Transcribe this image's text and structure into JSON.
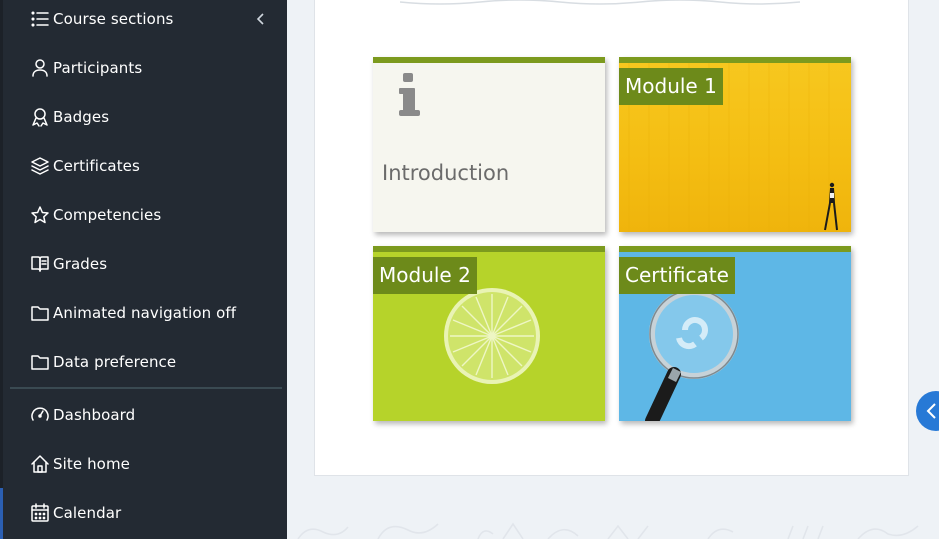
{
  "sidebar": {
    "collapse_icon": "chevron-left-icon",
    "items": [
      {
        "label": "Course sections",
        "icon": "list-icon"
      },
      {
        "label": "Participants",
        "icon": "user-icon"
      },
      {
        "label": "Badges",
        "icon": "badge-icon"
      },
      {
        "label": "Certificates",
        "icon": "layers-icon"
      },
      {
        "label": "Competencies",
        "icon": "star-icon"
      },
      {
        "label": "Grades",
        "icon": "book-icon"
      },
      {
        "label": "Animated navigation off",
        "icon": "folder-icon"
      },
      {
        "label": "Data preference",
        "icon": "folder-icon"
      }
    ],
    "site_items": [
      {
        "label": "Dashboard",
        "icon": "gauge-icon"
      },
      {
        "label": "Site home",
        "icon": "home-icon"
      },
      {
        "label": "Calendar",
        "icon": "calendar-icon"
      }
    ]
  },
  "tiles": [
    {
      "label": "Introduction",
      "icon": "info-icon"
    },
    {
      "label": "Module 1"
    },
    {
      "label": "Module 2"
    },
    {
      "label": "Certificate"
    }
  ],
  "drawer_toggle": {
    "icon": "chevron-left-icon"
  },
  "colors": {
    "sidebar_bg": "#232a33",
    "tile_bar": "#7c9a1e",
    "tile_tag": "#6d8a1a",
    "accent_blue": "#2779d6"
  }
}
